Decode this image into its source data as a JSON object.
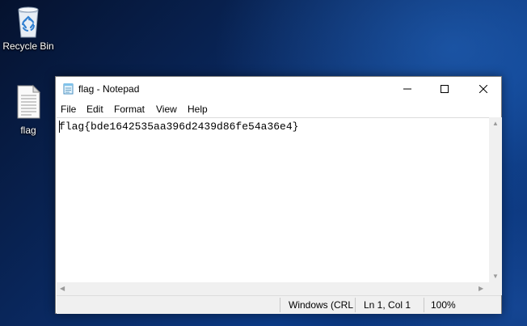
{
  "desktop": {
    "icons": [
      {
        "label": "Recycle Bin",
        "icon": "recycle-bin-icon"
      },
      {
        "label": "flag",
        "icon": "text-file-icon"
      }
    ]
  },
  "notepad": {
    "title": "flag - Notepad",
    "menu": [
      "File",
      "Edit",
      "Format",
      "View",
      "Help"
    ],
    "content": "flag{bde1642535aa396d2439d86fe54a36e4}",
    "status": {
      "encoding": "Windows (CRL",
      "position": "Ln 1, Col 1",
      "zoom": "100%"
    }
  },
  "colors": {
    "desktop_dark": "#05122e",
    "desktop_blue": "#0b3a85",
    "statusbar": "#f0f0f0"
  }
}
